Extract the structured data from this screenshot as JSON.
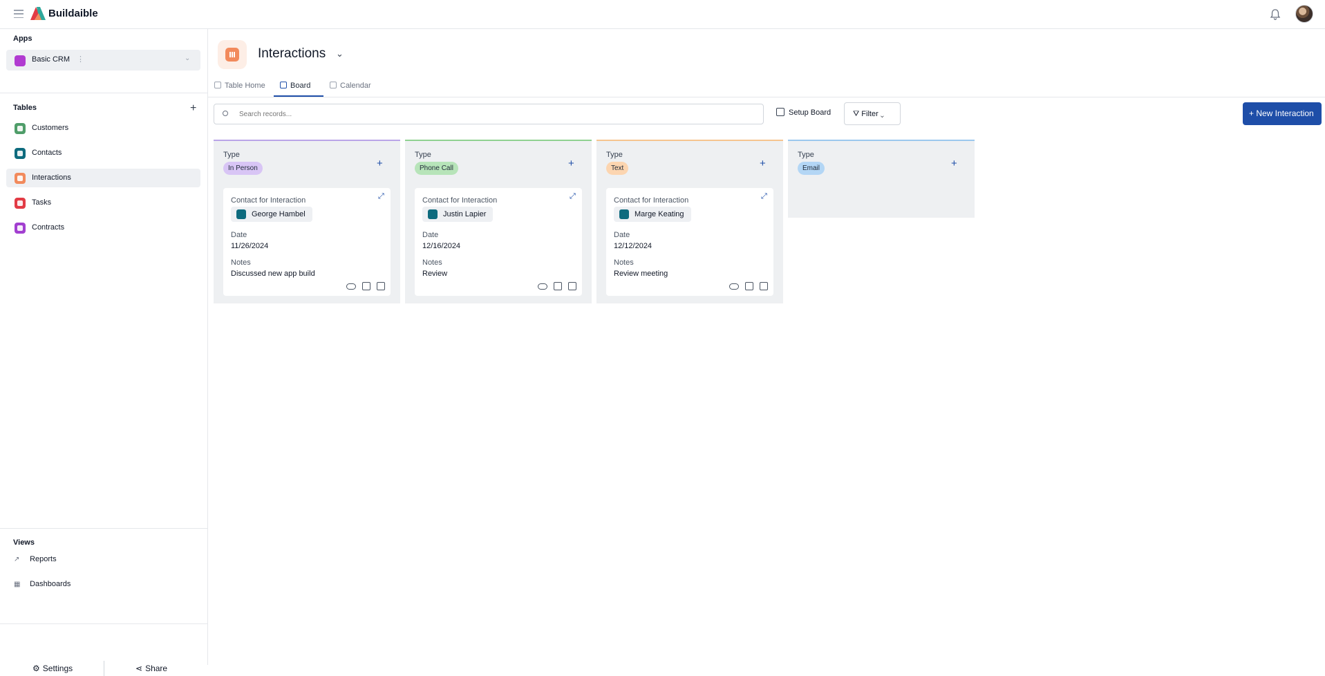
{
  "app": {
    "brand": "Buildaible"
  },
  "sidebar": {
    "apps_title": "Apps",
    "app_item": {
      "label": "Basic CRM",
      "color": "#b13bd1"
    },
    "tables_title": "Tables",
    "tables": [
      {
        "label": "Customers",
        "color": "#4f9d69",
        "icon": "people-icon"
      },
      {
        "label": "Contacts",
        "color": "#0e6b7e",
        "icon": "person-icon"
      },
      {
        "label": "Interactions",
        "color": "#f28a5c",
        "icon": "chart-icon",
        "active": true
      },
      {
        "label": "Tasks",
        "color": "#e23b45",
        "icon": "tag-icon"
      },
      {
        "label": "Contracts",
        "color": "#a23fd0",
        "icon": "document-icon"
      }
    ],
    "views_title": "Views",
    "views": [
      {
        "label": "Reports",
        "icon": "trend-icon"
      },
      {
        "label": "Dashboards",
        "icon": "grid-icon"
      }
    ],
    "settings_label": "Settings",
    "share_label": "Share"
  },
  "header": {
    "title": "Interactions",
    "tabs": [
      {
        "label": "Table Home"
      },
      {
        "label": "Board",
        "active": true
      },
      {
        "label": "Calendar"
      }
    ]
  },
  "toolbar": {
    "search_placeholder": "Search records...",
    "setup_label": "Setup Board",
    "filter_label": "Filter",
    "new_label": "+ New Interaction"
  },
  "board": {
    "columns": [
      {
        "type_label": "Type",
        "value": "In Person",
        "pill_color": "#d8c5f5",
        "top_color": "#b9a4e8",
        "cards": [
          {
            "contact_label": "Contact for Interaction",
            "contact": "George Hambel",
            "date_label": "Date",
            "date": "11/26/2024",
            "notes_label": "Notes",
            "notes": "Discussed new app build"
          }
        ]
      },
      {
        "type_label": "Type",
        "value": "Phone Call",
        "pill_color": "#b7e4b9",
        "top_color": "#8fd191",
        "cards": [
          {
            "contact_label": "Contact for Interaction",
            "contact": "Justin Lapier",
            "date_label": "Date",
            "date": "12/16/2024",
            "notes_label": "Notes",
            "notes": "Review"
          }
        ]
      },
      {
        "type_label": "Type",
        "value": "Text",
        "pill_color": "#fcd5b0",
        "top_color": "#f6c48f",
        "cards": [
          {
            "contact_label": "Contact for Interaction",
            "contact": "Marge Keating",
            "date_label": "Date",
            "date": "12/12/2024",
            "notes_label": "Notes",
            "notes": "Review meeting"
          }
        ]
      },
      {
        "type_label": "Type",
        "value": "Email",
        "pill_color": "#b3d6f5",
        "top_color": "#9cc8ee",
        "cards": []
      }
    ]
  }
}
